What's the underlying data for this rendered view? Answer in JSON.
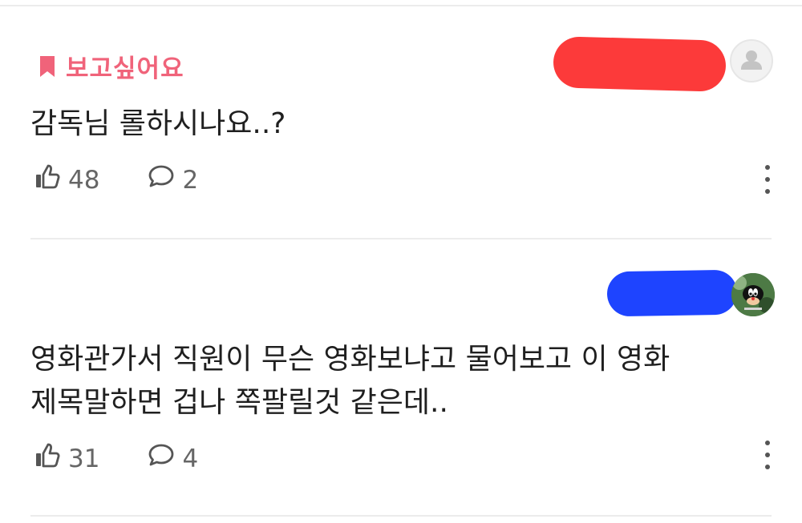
{
  "comments": [
    {
      "badge": "보고싶어요",
      "text": "감독님 롤하시나요..?",
      "likes": "48",
      "replies": "2",
      "avatar_icon": "default-user-icon"
    },
    {
      "badge": "",
      "text_line1": "영화관가서 직원이 무슨 영화보냐고 물어보고 이 영화",
      "text_line2": "제목말하면 겁나 쪽팔릴것 같은데..",
      "likes": "31",
      "replies": "4",
      "avatar_icon": "cartoon-avatar"
    }
  ],
  "colors": {
    "badge": "#f0637a",
    "redaction_red": "#fc3a3a",
    "redaction_blue": "#1e44ff",
    "text": "#1f1f1f",
    "meta": "#666666",
    "divider": "#ececec"
  },
  "icons": {
    "badge": "bookmark-icon",
    "like": "thumbs-up-icon",
    "reply": "speech-bubble-icon",
    "more": "more-vertical-icon"
  }
}
